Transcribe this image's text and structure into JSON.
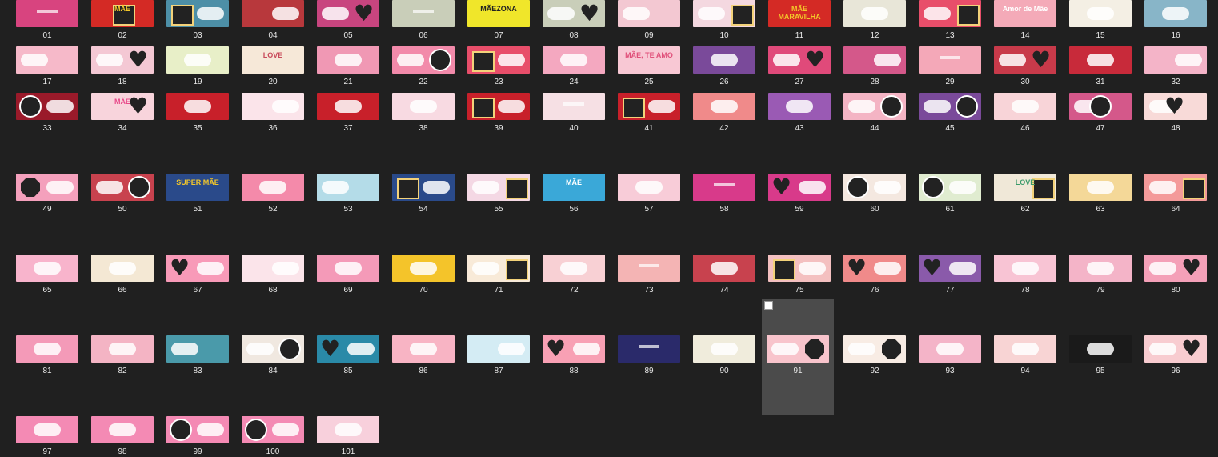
{
  "folder": {
    "selected_index": 91,
    "items": [
      {
        "label": "01",
        "bg": "#d8447f",
        "d": "deco2"
      },
      {
        "label": "02",
        "bg": "#d42a25",
        "s": "frame",
        "p": "c",
        "t": "MÃE",
        "tc": "#f3c72a"
      },
      {
        "label": "03",
        "bg": "#4d8fa7",
        "s": "frame",
        "p": "l",
        "d": "r"
      },
      {
        "label": "04",
        "bg": "#b8383c",
        "d": "r"
      },
      {
        "label": "05",
        "bg": "#c8457f",
        "s": "heart",
        "p": "r",
        "d": "l"
      },
      {
        "label": "06",
        "bg": "#c9ceb9",
        "d": "deco2"
      },
      {
        "label": "07",
        "bg": "#f0e62a",
        "t": "MÃEZONA",
        "tc": "#222"
      },
      {
        "label": "08",
        "bg": "#c9ceb9",
        "s": "heart",
        "p": "r",
        "d": "l"
      },
      {
        "label": "09",
        "bg": "#f3c8d2",
        "d": "l"
      },
      {
        "label": "10",
        "bg": "#f4d8e0",
        "s": "frame",
        "p": "r",
        "d": "l"
      },
      {
        "label": "11",
        "bg": "#d42a25",
        "t": "MÃE MARAVILHA",
        "tc": "#f3c72a"
      },
      {
        "label": "12",
        "bg": "#e8e6d8",
        "d": "c"
      },
      {
        "label": "13",
        "bg": "#e84e6a",
        "s": "frame",
        "p": "r",
        "d": "l"
      },
      {
        "label": "14",
        "bg": "#f4aab8",
        "t": "Amor de Mãe",
        "tc": "#fff"
      },
      {
        "label": "15",
        "bg": "#f4efe4",
        "d": "c"
      },
      {
        "label": "16",
        "bg": "#88b5c8",
        "d": "c"
      },
      {
        "label": "17",
        "bg": "#f6b9c9",
        "d": "l"
      },
      {
        "label": "18",
        "bg": "#f4c8d4",
        "s": "heart",
        "p": "r",
        "d": "l"
      },
      {
        "label": "19",
        "bg": "#e8efc8",
        "d": "c"
      },
      {
        "label": "20",
        "bg": "#f6e8d8",
        "t": "LOVE",
        "tc": "#c84a5a"
      },
      {
        "label": "21",
        "bg": "#f098b4",
        "d": "c"
      },
      {
        "label": "22",
        "bg": "#f28aaa",
        "s": "circle",
        "p": "r",
        "d": "l"
      },
      {
        "label": "23",
        "bg": "#e84e6a",
        "s": "frame",
        "p": "l",
        "d": "r"
      },
      {
        "label": "24",
        "bg": "#f4a8c0",
        "d": "c"
      },
      {
        "label": "25",
        "bg": "#f8c8d4",
        "t": "MÃE, TE AMO",
        "tc": "#e0507a"
      },
      {
        "label": "26",
        "bg": "#7a4a9a",
        "d": "c"
      },
      {
        "label": "27",
        "bg": "#e04a7a",
        "s": "heart",
        "p": "r",
        "d": "l"
      },
      {
        "label": "28",
        "bg": "#d4588a",
        "d": "r"
      },
      {
        "label": "29",
        "bg": "#f4a8b8",
        "d": "deco2"
      },
      {
        "label": "30",
        "bg": "#c83a4a",
        "s": "heart",
        "p": "r",
        "d": "l"
      },
      {
        "label": "31",
        "bg": "#c82a3a",
        "d": "c"
      },
      {
        "label": "32",
        "bg": "#f4b4c8",
        "d": "r"
      },
      {
        "label": "33",
        "bg": "#9a1a2a",
        "s": "circle",
        "p": "l",
        "d": "r"
      },
      {
        "label": "34",
        "bg": "#f8d4dc",
        "s": "heart",
        "p": "r",
        "t": "MÃE",
        "tc": "#e84a8a"
      },
      {
        "label": "35",
        "bg": "#c8202a",
        "d": "c"
      },
      {
        "label": "36",
        "bg": "#fbe4ea",
        "d": "r"
      },
      {
        "label": "37",
        "bg": "#c8202a",
        "d": "c"
      },
      {
        "label": "38",
        "bg": "#f8dae2",
        "d": "c"
      },
      {
        "label": "39",
        "bg": "#c8202a",
        "s": "frame",
        "p": "l",
        "d": "r"
      },
      {
        "label": "40",
        "bg": "#f6e0e4",
        "d": "deco2"
      },
      {
        "label": "41",
        "bg": "#c8202a",
        "s": "frame",
        "p": "l",
        "d": "r"
      },
      {
        "label": "42",
        "bg": "#f08a8a",
        "d": "c"
      },
      {
        "label": "43",
        "bg": "#9a5ab4",
        "d": "c"
      },
      {
        "label": "44",
        "bg": "#f4b4c4",
        "s": "circle",
        "p": "r",
        "d": "l"
      },
      {
        "label": "45",
        "bg": "#7a4a9a",
        "s": "circle",
        "p": "r",
        "d": "l"
      },
      {
        "label": "46",
        "bg": "#f8d4d8",
        "d": "c"
      },
      {
        "label": "47",
        "bg": "#d4588a",
        "s": "circle",
        "p": "c",
        "d": "l"
      },
      {
        "label": "48",
        "bg": "#f8dad8",
        "s": "heart",
        "p": "c",
        "d": "l"
      },
      {
        "label": "49",
        "bg": "#f4a0bc",
        "s": "octa",
        "p": "l",
        "d": "r"
      },
      {
        "label": "50",
        "bg": "#c8424e",
        "s": "circle",
        "p": "r",
        "d": "l"
      },
      {
        "label": "51",
        "bg": "#2a4a8a",
        "t": "SUPER MÃE",
        "tc": "#f3c72a"
      },
      {
        "label": "52",
        "bg": "#f48aaa",
        "d": "c"
      },
      {
        "label": "53",
        "bg": "#b4dce8",
        "d": "l"
      },
      {
        "label": "54",
        "bg": "#2a4a8a",
        "s": "frame",
        "p": "l",
        "d": "r"
      },
      {
        "label": "55",
        "bg": "#f4d8e4",
        "s": "frame",
        "p": "r",
        "d": "l"
      },
      {
        "label": "56",
        "bg": "#3aa8d8",
        "t": "MÃE",
        "tc": "#fff"
      },
      {
        "label": "57",
        "bg": "#f8ccd8",
        "d": "c"
      },
      {
        "label": "58",
        "bg": "#d83a8a",
        "d": "deco2"
      },
      {
        "label": "59",
        "bg": "#d83a8a",
        "s": "heart",
        "p": "l",
        "d": "r"
      },
      {
        "label": "60",
        "bg": "#f4e8e0",
        "s": "circle",
        "p": "l",
        "d": "r"
      },
      {
        "label": "61",
        "bg": "#e0ecd0",
        "s": "circle",
        "p": "l",
        "d": "r"
      },
      {
        "label": "62",
        "bg": "#f0e8d8",
        "s": "frame",
        "p": "r",
        "t": "LOVE",
        "tc": "#3a9a6a"
      },
      {
        "label": "63",
        "bg": "#f4d898",
        "d": "c"
      },
      {
        "label": "64",
        "bg": "#f49a9a",
        "s": "frame",
        "p": "r",
        "d": "l"
      },
      {
        "label": "65",
        "bg": "#f8b4cc",
        "d": "c"
      },
      {
        "label": "66",
        "bg": "#f4e8d4",
        "d": "c"
      },
      {
        "label": "67",
        "bg": "#f89ab8",
        "s": "heart",
        "p": "l",
        "d": "r"
      },
      {
        "label": "68",
        "bg": "#fbe4ea",
        "d": "r"
      },
      {
        "label": "69",
        "bg": "#f49ab8",
        "d": "c"
      },
      {
        "label": "70",
        "bg": "#f4c42a",
        "d": "c"
      },
      {
        "label": "71",
        "bg": "#f8ead8",
        "s": "frame",
        "p": "r",
        "d": "l"
      },
      {
        "label": "72",
        "bg": "#f8d0d4",
        "d": "c"
      },
      {
        "label": "73",
        "bg": "#f4b4b4",
        "d": "deco2"
      },
      {
        "label": "74",
        "bg": "#c8424e",
        "d": "c"
      },
      {
        "label": "75",
        "bg": "#f4c0c0",
        "s": "frame",
        "p": "l",
        "d": "r"
      },
      {
        "label": "76",
        "bg": "#f08a8a",
        "s": "heart",
        "p": "l",
        "d": "r"
      },
      {
        "label": "77",
        "bg": "#8a5aaa",
        "s": "heart",
        "p": "l",
        "d": "r"
      },
      {
        "label": "78",
        "bg": "#f8c4d4",
        "d": "c"
      },
      {
        "label": "79",
        "bg": "#f4b4c8",
        "d": "c"
      },
      {
        "label": "80",
        "bg": "#f4a0b8",
        "s": "heart",
        "p": "r",
        "d": "l"
      },
      {
        "label": "81",
        "bg": "#f49ab8",
        "d": "c"
      },
      {
        "label": "82",
        "bg": "#f4b4c4",
        "d": "c"
      },
      {
        "label": "83",
        "bg": "#4a9aaa",
        "d": "l"
      },
      {
        "label": "84",
        "bg": "#f0e8e0",
        "s": "circle",
        "p": "r",
        "d": "l"
      },
      {
        "label": "85",
        "bg": "#2a8aa8",
        "s": "heart",
        "p": "l",
        "d": "r"
      },
      {
        "label": "86",
        "bg": "#f8b4c4",
        "d": "c"
      },
      {
        "label": "87",
        "bg": "#d4ecf4",
        "d": "r"
      },
      {
        "label": "88",
        "bg": "#f8a0b4",
        "s": "heart",
        "p": "l",
        "d": "r"
      },
      {
        "label": "89",
        "bg": "#2a2a6a",
        "d": "deco2"
      },
      {
        "label": "90",
        "bg": "#f0ecdc",
        "d": "c"
      },
      {
        "label": "91",
        "bg": "#f8c4cc",
        "s": "octa",
        "p": "r",
        "d": "l"
      },
      {
        "label": "92",
        "bg": "#f8ece4",
        "s": "octa",
        "p": "r",
        "d": "l"
      },
      {
        "label": "93",
        "bg": "#f4b4c8",
        "d": "c"
      },
      {
        "label": "94",
        "bg": "#f8d4d4",
        "d": "c"
      },
      {
        "label": "95",
        "bg": "#1a1a1a",
        "d": "c"
      },
      {
        "label": "96",
        "bg": "#f8ccd0",
        "s": "heart",
        "p": "r",
        "d": "l"
      },
      {
        "label": "97",
        "bg": "#f48ab4",
        "d": "c"
      },
      {
        "label": "98",
        "bg": "#f48ab4",
        "d": "c"
      },
      {
        "label": "99",
        "bg": "#f48ab4",
        "s": "circle",
        "p": "l",
        "d": "r"
      },
      {
        "label": "100",
        "bg": "#f48ab4",
        "s": "circle",
        "p": "l",
        "d": "r"
      },
      {
        "label": "101",
        "bg": "#f8d0dc",
        "d": "c"
      }
    ]
  }
}
